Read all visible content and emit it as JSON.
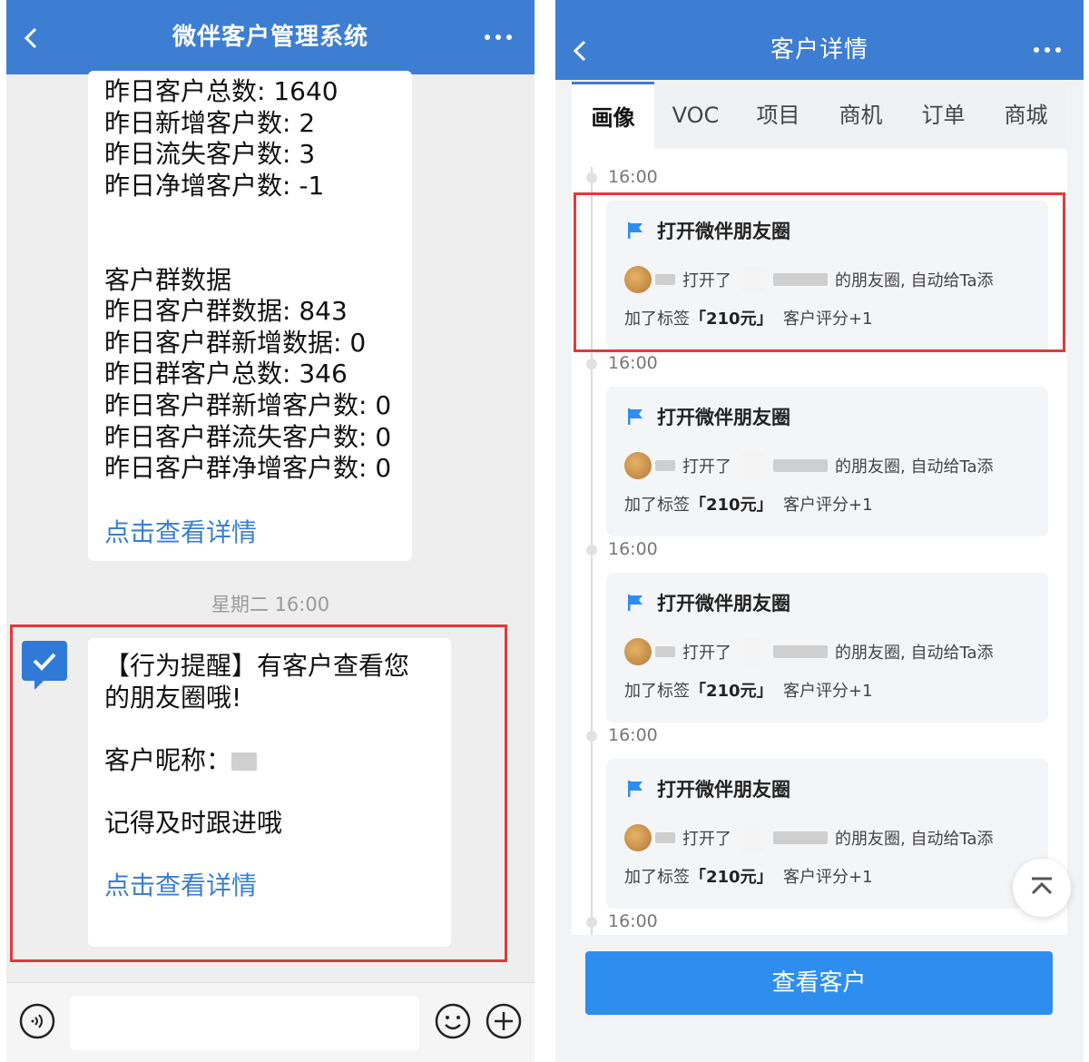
{
  "left": {
    "title": "微伴客户管理系统",
    "stats_lines": [
      "昨日客户总数: 1640",
      "昨日新增客户数: 2",
      "昨日流失客户数: 3",
      "昨日净增客户数: -1",
      "",
      "",
      "客户群数据",
      "昨日客户群数据: 843",
      "昨日客户群新增数据: 0",
      "昨日群客户总数: 346",
      "昨日客户群新增客户数: 0",
      "昨日客户群流失客户数: 0",
      "昨日客户群净增客户数: 0"
    ],
    "stats_link": "点击查看详情",
    "timestamp": "星期二 16:00",
    "alert": {
      "line1": "【行为提醒】有客户查看您",
      "line2": "的朋友圈哦!",
      "nickname_label": "客户昵称：",
      "follow_up": "记得及时跟进哦",
      "link": "点击查看详情"
    }
  },
  "right": {
    "title": "客户详情",
    "tabs": [
      "画像",
      "VOC",
      "项目",
      "商机",
      "订单",
      "商城"
    ],
    "events": [
      {
        "time": "16:00",
        "title": "打开微伴朋友圈",
        "opened": "打开了",
        "suffix": "的朋友圈, 自动给Ta添",
        "tag_prefix": "加了标签",
        "tag": "「210元」",
        "score": "客户评分+1"
      },
      {
        "time": "16:00",
        "title": "打开微伴朋友圈",
        "opened": "打开了",
        "suffix": "的朋友圈, 自动给Ta添",
        "tag_prefix": "加了标签",
        "tag": "「210元」",
        "score": "客户评分+1"
      },
      {
        "time": "16:00",
        "title": "打开微伴朋友圈",
        "opened": "打开了",
        "suffix": "的朋友圈, 自动给Ta添",
        "tag_prefix": "加了标签",
        "tag": "「210元」",
        "score": "客户评分+1"
      },
      {
        "time": "16:00",
        "title": "打开微伴朋友圈",
        "opened": "打开了",
        "suffix": "的朋友圈, 自动给Ta添",
        "tag_prefix": "加了标签",
        "tag": "「210元」",
        "score": "客户评分+1"
      }
    ],
    "last_time": "16:00",
    "button": "查看客户"
  },
  "colors": {
    "nav": "#3e7ed2",
    "link": "#3a7fd0",
    "highlight": "#e03a3a",
    "button": "#2e8ef0"
  }
}
